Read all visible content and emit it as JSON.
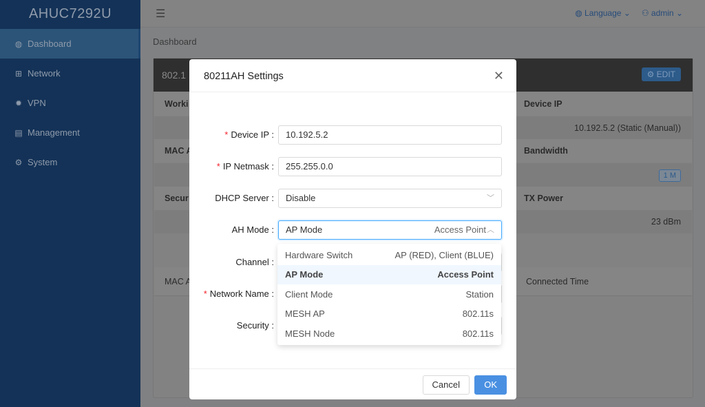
{
  "app": {
    "title": "AHUC7292U"
  },
  "sidebar": {
    "items": [
      {
        "label": "Dashboard",
        "icon": "globe-icon",
        "active": true
      },
      {
        "label": "Network",
        "icon": "network-icon"
      },
      {
        "label": "VPN",
        "icon": "gear-icon"
      },
      {
        "label": "Management",
        "icon": "server-icon"
      },
      {
        "label": "System",
        "icon": "gears-icon"
      }
    ]
  },
  "header": {
    "language": "Language",
    "user": "admin"
  },
  "breadcrumb": "Dashboard",
  "card": {
    "title": "802.1",
    "edit": "EDIT",
    "left_labels": [
      "Worki",
      "MAC A",
      "Secur"
    ],
    "right_labels": [
      "Device IP",
      "Bandwidth",
      "TX Power"
    ],
    "values": [
      "10.192.5.2 (Static (Manual))",
      "1 M",
      "23 dBm"
    ],
    "table_headers": [
      "MAC A",
      "Connected Time"
    ]
  },
  "modal": {
    "title": "80211AH Settings",
    "fields": [
      {
        "label": "Device IP",
        "required": true,
        "value": "10.192.5.2"
      },
      {
        "label": "IP Netmask",
        "required": true,
        "value": "255.255.0.0"
      },
      {
        "label": "DHCP Server",
        "required": false,
        "value": "Disable"
      },
      {
        "label": "AH Mode",
        "required": false,
        "value": "AP Mode",
        "value_right": "Access Point"
      },
      {
        "label": "Channel",
        "required": false
      },
      {
        "label": "Network Name",
        "required": true
      },
      {
        "label": "Security",
        "required": false
      }
    ],
    "dropdown": [
      {
        "label": "Hardware Switch",
        "desc": "AP (RED), Client (BLUE)"
      },
      {
        "label": "AP Mode",
        "desc": "Access Point",
        "selected": true
      },
      {
        "label": "Client Mode",
        "desc": "Station"
      },
      {
        "label": "MESH AP",
        "desc": "802.11s"
      },
      {
        "label": "MESH Node",
        "desc": "802.11s"
      }
    ],
    "cancel": "Cancel",
    "ok": "OK"
  },
  "colors": {
    "accent": "#4a90e2",
    "annotation_arrow": "#f26b1d",
    "required": "#f5222d"
  }
}
